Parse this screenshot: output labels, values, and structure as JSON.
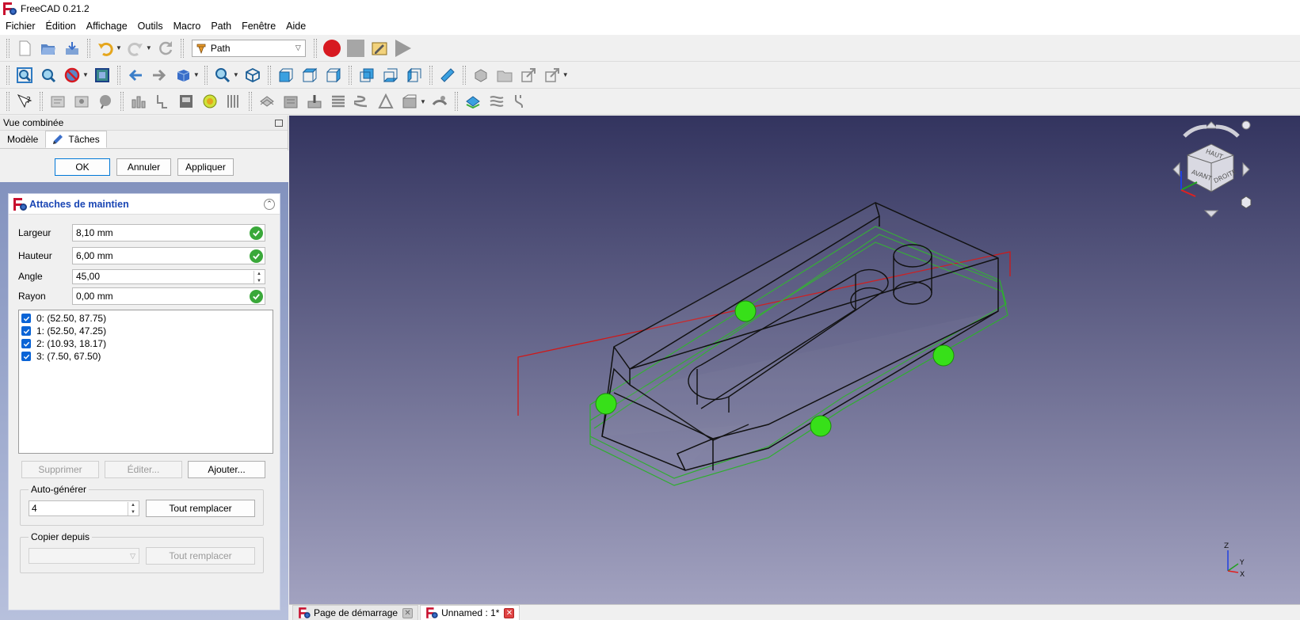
{
  "window": {
    "title": "FreeCAD 0.21.2"
  },
  "menu": [
    "Fichier",
    "Édition",
    "Affichage",
    "Outils",
    "Macro",
    "Path",
    "Fenêtre",
    "Aide"
  ],
  "toolbar": {
    "workbench": "Path"
  },
  "combo": {
    "title": "Vue combinée",
    "tabs": {
      "model": "Modèle",
      "tasks": "Tâches"
    }
  },
  "task": {
    "ok": "OK",
    "cancel": "Annuler",
    "apply": "Appliquer",
    "box_title": "Attaches de maintien",
    "fields": {
      "width_label": "Largeur",
      "width_value": "8,10 mm",
      "height_label": "Hauteur",
      "height_value": "6,00 mm",
      "angle_label": "Angle",
      "angle_value": "45,00",
      "radius_label": "Rayon",
      "radius_value": "0,00 mm"
    },
    "points": [
      "0: (52.50, 87.75)",
      "1: (52.50, 47.25)",
      "2: (10.93, 18.17)",
      "3: (7.50, 67.50)"
    ],
    "delete": "Supprimer",
    "edit": "Éditer...",
    "add": "Ajouter...",
    "autogen": {
      "title": "Auto-générer",
      "value": "4",
      "replace": "Tout remplacer"
    },
    "copy": {
      "title": "Copier depuis",
      "replace": "Tout remplacer"
    }
  },
  "navcube": {
    "top": "HAUT",
    "front": "AVANT",
    "right": "DROITE"
  },
  "axes": {
    "x": "X",
    "y": "Y",
    "z": "Z"
  },
  "bottom_tabs": {
    "start": "Page de démarrage",
    "doc": "Unnamed : 1*"
  },
  "colors": {
    "path_green": "#2fae2f",
    "holder_green": "#37e019",
    "stock_red": "#d01818",
    "view_top": "#33345f",
    "view_bottom": "#a2a2c0"
  }
}
